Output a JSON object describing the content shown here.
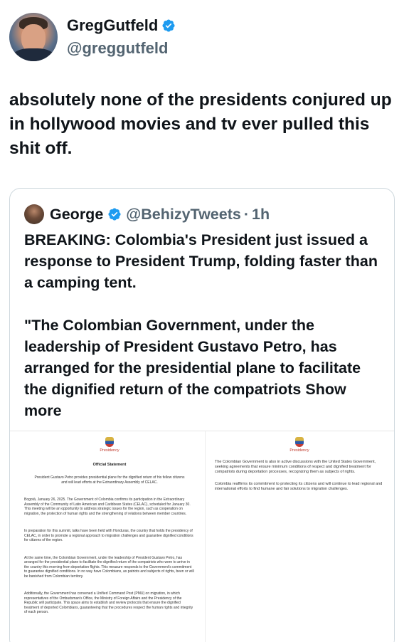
{
  "author": {
    "display_name": "GregGutfeld",
    "handle": "@greggutfeld"
  },
  "tweet": {
    "text": "absolutely none of the presidents conjured up in hollywood movies and tv ever pulled this shit off."
  },
  "quoted": {
    "display_name": "George",
    "handle": "@BehizyTweets",
    "separator": "·",
    "time": "1h",
    "paragraph1": "BREAKING: Colombia's President just issued a response to President Trump, folding faster than a camping tent.",
    "paragraph2": "\"The Colombian Government, under the leadership of President Gustavo Petro, has arranged for the presidential plane to facilitate the dignified return of the compatriots",
    "show_more": "Show more",
    "doc_left": {
      "presidency": "Presidency",
      "title": "Official Statement",
      "subtitle": "President Gustavo Petro provides presidential plane for the dignified return of his fellow citizens and will lead efforts at the Extraordinary Assembly of CELAC.",
      "p1": "Bogotá, January 26, 2025. The Government of Colombia confirms its participation in the Extraordinary Assembly of the Community of Latin American and Caribbean States (CELAC), scheduled for January 30. This meeting will be an opportunity to address strategic issues for the region, such as cooperation on migration, the protection of human rights and the strengthening of relations between member countries.",
      "p2": "In preparation for this summit, talks have been held with Honduras, the country that holds the presidency of CELAC, in order to promote a regional approach to migration challenges and guarantee dignified conditions for citizens of the region.",
      "p3": "At the same time, the Colombian Government, under the leadership of President Gustavo Petro, has arranged for the presidential plane to facilitate the dignified return of the compatriots who were to arrive in the country this morning from deportation flights. This measure responds to the Government's commitment to guarantee dignified conditions. In no way have Colombians, as patriots and subjects of rights, been or will be banished from Colombian territory.",
      "p4": "Additionally, the Government has convened a Unified Command Post (PMU) on migration, in which representatives of the Ombudsman's Office, the Ministry of Foreign Affairs and the Presidency of the Republic will participate. This space aims to establish and review protocols that ensure the dignified treatment of deported Colombians, guaranteeing that the procedures respect the human rights and integrity of each person."
    },
    "doc_right": {
      "presidency": "Presidency",
      "p1": "The Colombian Government is also in active discussions with the United States Government, seeking agreements that ensure minimum conditions of respect and dignified treatment for compatriots during deportation processes, recognizing them as subjects of rights.",
      "p2": "Colombia reaffirms its commitment to protecting its citizens and will continue to lead regional and international efforts to find humane and fair solutions to migration challenges."
    }
  },
  "colors": {
    "verified": "#1d9bf0",
    "text": "#0f1419",
    "secondary": "#536471",
    "border": "#cfd9de"
  }
}
